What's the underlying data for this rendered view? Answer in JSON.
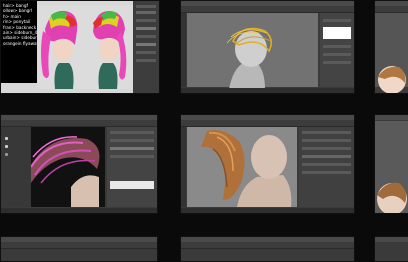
{
  "hair_list": [
    "hair> bangf",
    "ollow> bangrl",
    "h> main",
    "rin> ponytail",
    "fran> backneck",
    "ain> sideburn_4",
    "urbain> sideburn_4",
    "orangein flyaway"
  ],
  "colors": {
    "background": "#0a0a0a",
    "ui_dark": "#3a3a3a",
    "viewport": "#6b6b6b"
  }
}
